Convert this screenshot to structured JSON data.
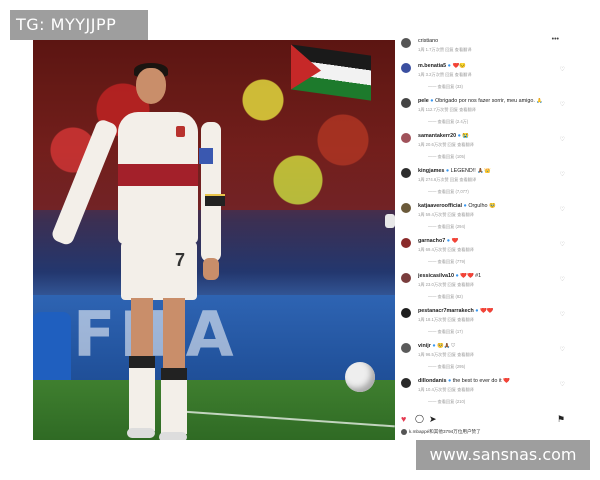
{
  "watermarks": {
    "top_left": "TG: MYYJJPP",
    "bottom_right": "www.sansnas.com"
  },
  "photo": {
    "board_text": "FIFA",
    "jersey_number": "7"
  },
  "post": {
    "partial_top_username": "cristiano",
    "partial_top_meta": "1周 1.7万次赞 回复 查看翻译"
  },
  "comments": [
    {
      "username": "m.benatia5",
      "suffix": "❤️😔",
      "meta": "1周 3.2万次赞 回复 查看翻译",
      "replies": "—— 查看回复 (33)",
      "avatar_color": "#3b4fa0"
    },
    {
      "username": "pele",
      "suffix": "Obrigado por nos fazer sorrir, meu amigo. 🙏",
      "meta": "1周 112.7万次赞 回复 查看翻译",
      "replies": "—— 查看回复 (2.4万)",
      "avatar_color": "#444444"
    },
    {
      "username": "samantakerr20",
      "suffix": "😭",
      "meta": "1周 20.6万次赞 回复 查看翻译",
      "replies": "—— 查看回复 (105)",
      "avatar_color": "#a0525a"
    },
    {
      "username": "kingjames",
      "suffix": "LEGEND!! 🙏🏾👑",
      "meta": "1周 274.6万次赞 回复 查看翻译",
      "replies": "—— 查看回复 (7,077)",
      "avatar_color": "#2d2d2d"
    },
    {
      "username": "katjaaveroofficial",
      "suffix": "Orgulho 🥹",
      "meta": "1周 59.4万次赞 回复 查看翻译",
      "replies": "—— 查看回复 (294)",
      "avatar_color": "#6b5a3a"
    },
    {
      "username": "garnacho7",
      "suffix": "❤️",
      "meta": "1周 69.4万次赞 回复 查看翻译",
      "replies": "—— 查看回复 (779)",
      "avatar_color": "#8a2a2a"
    },
    {
      "username": "jessicasilva10",
      "suffix": "❤️❤️ #1",
      "meta": "1周 23.0万次赞 回复 查看翻译",
      "replies": "—— 查看回复 (82)",
      "avatar_color": "#7a3d3d"
    },
    {
      "username": "pestanacr7marrakech",
      "suffix": "❤️❤️",
      "meta": "1周 18.1万次赞 回复 查看翻译",
      "replies": "—— 查看回复 (17)",
      "avatar_color": "#1e1e1e"
    },
    {
      "username": "vinijr",
      "suffix": "🥺🙏🏾♡",
      "meta": "1周 96.5万次赞 回复 查看翻译",
      "replies": "—— 查看回复 (295)",
      "avatar_color": "#5a5a5a"
    },
    {
      "username": "dillondanis",
      "suffix": "the best to ever do it ❤️",
      "meta": "1周 10.4万次赞 回复 查看翻译",
      "replies": "—— 查看回复 (210)",
      "avatar_color": "#2a2a2a"
    }
  ],
  "actions": {
    "like_icon": "♥",
    "comment_icon": "◯",
    "share_icon": "➤",
    "save_icon": "⚑"
  },
  "likes_text": "k.mbappé和其他3794万位用户赞了"
}
